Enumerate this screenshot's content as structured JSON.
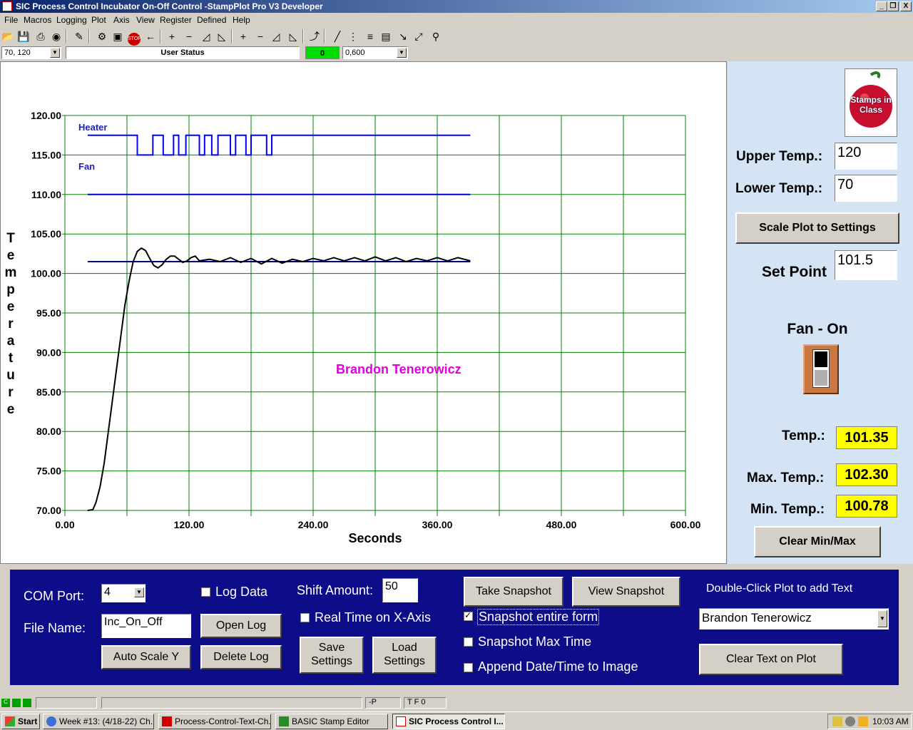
{
  "window": {
    "title": "SIC Process Control Incubator On-Off Control -StampPlot Pro V3 Developer",
    "controls": [
      "_",
      "❐",
      "X"
    ]
  },
  "menu": [
    "File",
    "Macros",
    "Logging",
    "Plot",
    "Axis",
    "View",
    "Register",
    "Defined",
    "Help"
  ],
  "toolbar": {
    "coords": "70, 120",
    "user_status": "User Status",
    "counter": "0",
    "range": "0,600"
  },
  "chart_data": {
    "type": "line",
    "title": "",
    "xlabel": "Seconds",
    "ylabel": "Temperature",
    "xlim": [
      0,
      600
    ],
    "ylim": [
      70,
      120
    ],
    "x_ticks": [
      "0.00",
      "120.00",
      "240.00",
      "360.00",
      "480.00",
      "600.00"
    ],
    "y_ticks": [
      "120.00",
      "115.00",
      "110.00",
      "105.00",
      "100.00",
      "95.00",
      "90.00",
      "85.00",
      "80.00",
      "75.00",
      "70.00"
    ],
    "grid": true,
    "annotation": "Brandon Tenerowicz",
    "series": [
      {
        "name": "Heater",
        "color": "#0000ff",
        "points": [
          [
            22,
            117.5
          ],
          [
            70,
            117.5
          ],
          [
            70,
            115
          ],
          [
            85,
            115
          ],
          [
            85,
            117.5
          ],
          [
            95,
            117.5
          ],
          [
            95,
            115
          ],
          [
            105,
            115
          ],
          [
            105,
            117.5
          ],
          [
            110,
            117.5
          ],
          [
            110,
            115
          ],
          [
            117,
            115
          ],
          [
            117,
            117.5
          ],
          [
            130,
            117.5
          ],
          [
            130,
            115
          ],
          [
            135,
            115
          ],
          [
            135,
            117.5
          ],
          [
            142,
            117.5
          ],
          [
            142,
            115
          ],
          [
            148,
            115
          ],
          [
            148,
            117.5
          ],
          [
            160,
            117.5
          ],
          [
            160,
            115
          ],
          [
            165,
            115
          ],
          [
            165,
            117.5
          ],
          [
            175,
            117.5
          ],
          [
            175,
            115
          ],
          [
            180,
            115
          ],
          [
            180,
            117.5
          ],
          [
            195,
            117.5
          ],
          [
            195,
            115
          ],
          [
            200,
            115
          ],
          [
            200,
            117.5
          ],
          [
            392,
            117.5
          ]
        ]
      },
      {
        "name": "Fan",
        "color": "#0000c8",
        "points": [
          [
            22,
            110
          ],
          [
            392,
            110
          ]
        ]
      },
      {
        "name": "Set Point",
        "color": "#000080",
        "points": [
          [
            22,
            101.5
          ],
          [
            392,
            101.5
          ]
        ]
      },
      {
        "name": "Temperature",
        "color": "#000000",
        "points": [
          [
            22,
            70
          ],
          [
            27,
            70.1
          ],
          [
            30,
            71
          ],
          [
            34,
            73
          ],
          [
            38,
            76
          ],
          [
            42,
            80
          ],
          [
            46,
            84
          ],
          [
            50,
            88
          ],
          [
            54,
            92
          ],
          [
            58,
            96
          ],
          [
            62,
            99
          ],
          [
            66,
            101.5
          ],
          [
            70,
            102.8
          ],
          [
            74,
            103.2
          ],
          [
            78,
            102.9
          ],
          [
            82,
            101.9
          ],
          [
            86,
            101
          ],
          [
            90,
            100.7
          ],
          [
            94,
            101.1
          ],
          [
            98,
            101.8
          ],
          [
            102,
            102.2
          ],
          [
            106,
            102.2
          ],
          [
            110,
            101.8
          ],
          [
            114,
            101.4
          ],
          [
            118,
            101.6
          ],
          [
            122,
            102
          ],
          [
            126,
            102.2
          ],
          [
            130,
            101.6
          ],
          [
            140,
            101.8
          ],
          [
            150,
            101.5
          ],
          [
            160,
            102
          ],
          [
            170,
            101.4
          ],
          [
            180,
            101.9
          ],
          [
            190,
            101.2
          ],
          [
            200,
            101.9
          ],
          [
            210,
            101.3
          ],
          [
            220,
            101.8
          ],
          [
            230,
            101.5
          ],
          [
            240,
            101.9
          ],
          [
            250,
            101.6
          ],
          [
            260,
            102
          ],
          [
            270,
            101.6
          ],
          [
            280,
            102
          ],
          [
            290,
            101.6
          ],
          [
            300,
            102.1
          ],
          [
            310,
            101.6
          ],
          [
            320,
            102
          ],
          [
            330,
            101.5
          ],
          [
            340,
            101.9
          ],
          [
            350,
            101.6
          ],
          [
            360,
            102
          ],
          [
            370,
            101.6
          ],
          [
            380,
            102
          ],
          [
            392,
            101.6
          ]
        ]
      }
    ]
  },
  "plot_labels": {
    "heater": "Heater",
    "fan": "Fan"
  },
  "right_panel": {
    "logo_text": "Stamps in Class",
    "upper_temp_label": "Upper Temp.:",
    "upper_temp_value": "120",
    "lower_temp_label": "Lower Temp.:",
    "lower_temp_value": "70",
    "scale_button": "Scale Plot to Settings",
    "set_point_label": "Set Point",
    "set_point_value": "101.5",
    "fan_status": "Fan - On",
    "temp_label": "Temp.:",
    "temp_value": "101.35",
    "max_label": "Max. Temp.:",
    "max_value": "102.30",
    "min_label": "Min. Temp.:",
    "min_value": "100.78",
    "clear_minmax": "Clear Min/Max"
  },
  "bottom_panel": {
    "com_port_label": "COM Port:",
    "com_port_value": "4",
    "file_name_label": "File Name:",
    "file_name_value": "Inc_On_Off",
    "log_data_label": "Log Data",
    "open_log": "Open Log",
    "auto_scale": "Auto Scale Y",
    "delete_log": "Delete Log",
    "shift_label": "Shift Amount:",
    "shift_value": "50",
    "realtime_label": "Real Time on X-Axis",
    "save_settings_1": "Save",
    "save_settings_2": "Settings",
    "load_settings_1": "Load",
    "load_settings_2": "Settings",
    "take_snapshot": "Take Snapshot",
    "view_snapshot": "View Snapshot",
    "snapshot_form": "Snapshot entire form",
    "snapshot_max": "Snapshot Max Time",
    "append_date": "Append Date/Time to Image",
    "double_click_hint": "Double-Click Plot to add Text",
    "text_select": "Brandon Tenerowicz",
    "clear_text": "Clear Text on Plot"
  },
  "statusbar": {
    "p": "-P",
    "tf": "T F 0"
  },
  "taskbar": {
    "start": "Start",
    "tasks": [
      "Week #13: (4/18-22) Ch...",
      "Process-Control-Text-Ch...",
      "BASIC Stamp Editor",
      "SIC Process Control I..."
    ],
    "clock": "10:03 AM"
  }
}
